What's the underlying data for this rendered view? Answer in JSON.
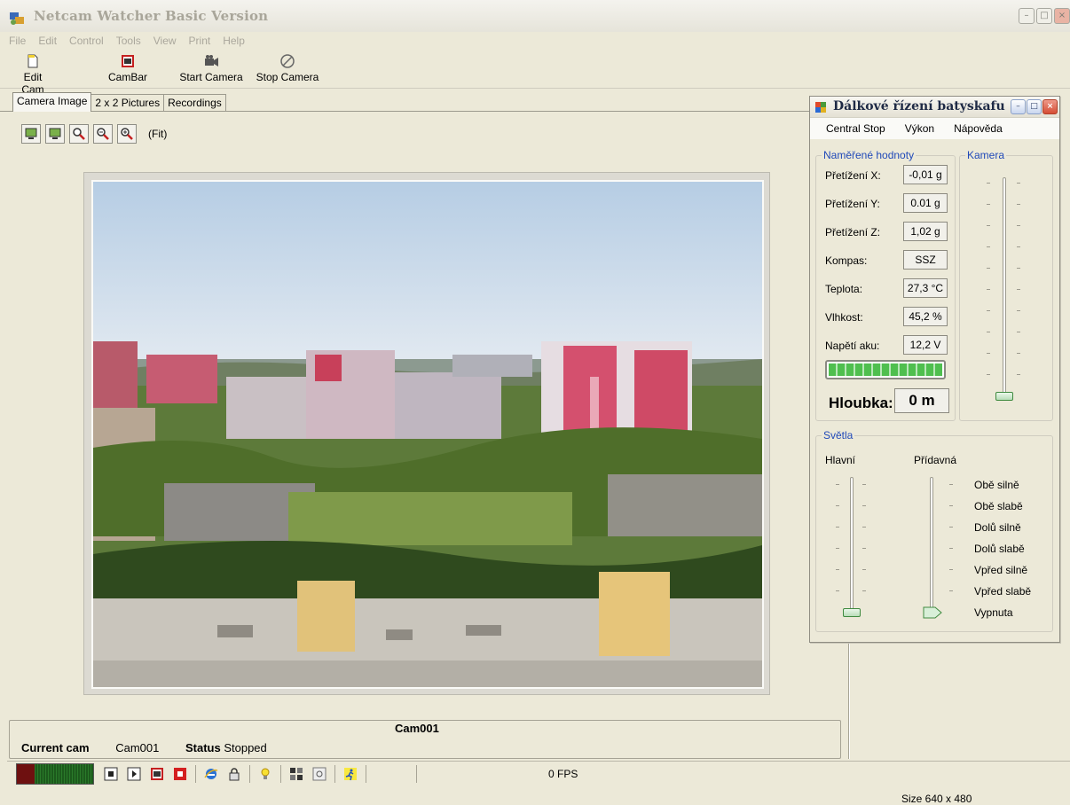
{
  "window": {
    "title": "Netcam Watcher Basic Version"
  },
  "menu": [
    "File",
    "Edit",
    "Control",
    "Tools",
    "View",
    "Print",
    "Help"
  ],
  "toolbar": {
    "edit_cam": "Edit Cam",
    "cambar": "CamBar",
    "start_camera": "Start Camera",
    "stop_camera": "Stop Camera"
  },
  "tabs": [
    "Camera Image",
    "2 x 2 Pictures",
    "Recordings"
  ],
  "view": {
    "fit_label": "(Fit)"
  },
  "camera": {
    "heading": "Cam001",
    "current_cam_label": "Current cam",
    "current_cam_value": "Cam001",
    "status_label": "Status",
    "status_value": "Stopped"
  },
  "statusbar": {
    "fps": "0 FPS",
    "size": "Size 640 x 480"
  },
  "dialog": {
    "title": "Dálkové řízení batyskafu",
    "menu": [
      "Central Stop",
      "Výkon",
      "Nápověda"
    ],
    "measured": {
      "legend": "Naměřené hodnoty",
      "rows": [
        {
          "label": "Přetížení X:",
          "value": "-0,01 g"
        },
        {
          "label": "Přetížení Y:",
          "value": "0.01 g"
        },
        {
          "label": "Přetížení Z:",
          "value": "1,02 g"
        },
        {
          "label": "Kompas:",
          "value": "SSZ"
        },
        {
          "label": "Teplota:",
          "value": "27,3 °C"
        },
        {
          "label": "Vlhkost:",
          "value": "45,2 %"
        },
        {
          "label": "Napětí aku:",
          "value": "12,2 V"
        }
      ],
      "battery_level": 1.0,
      "depth_label": "Hloubka:",
      "depth_value": "0 m"
    },
    "camera_group": {
      "legend": "Kamera"
    },
    "lights": {
      "legend": "Světla",
      "main_label": "Hlavní",
      "extra_label": "Přídavná",
      "options": [
        "Obě silně",
        "Obě slabě",
        "Dolů silně",
        "Dolů slabě",
        "Vpřed silně",
        "Vpřed slabě",
        "Vypnuta"
      ]
    }
  },
  "colors": {
    "accent_blue": "#2049b8",
    "meter_green": "#2a7a2a",
    "meter_red": "#6e1010",
    "battery_green": "#4fbf4f"
  }
}
